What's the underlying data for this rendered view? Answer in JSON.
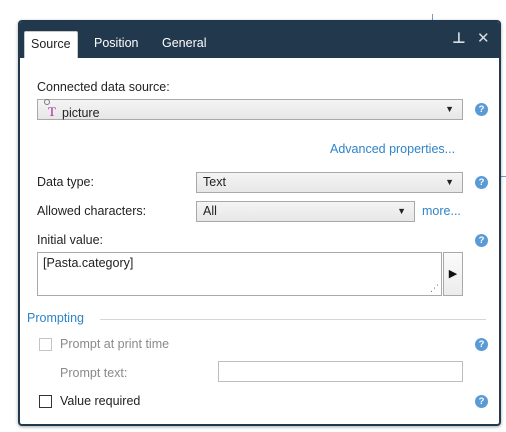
{
  "tabs": [
    "Source",
    "Position",
    "General"
  ],
  "titlebar": {
    "pin_glyph": "⊥",
    "close_glyph": "✕"
  },
  "connected_source": {
    "label": "Connected data source:",
    "value": "picture",
    "icon": "text-variable-icon",
    "icon_glyph": "T"
  },
  "advanced_link": "Advanced properties...",
  "data_type": {
    "label": "Data type:",
    "value": "Text"
  },
  "allowed_chars": {
    "label": "Allowed characters:",
    "value": "All",
    "more_link": "more..."
  },
  "initial_value": {
    "label": "Initial value:",
    "value": "[Pasta.category]",
    "insert_glyph": "▶"
  },
  "prompting": {
    "title": "Prompting",
    "prompt_at_print": {
      "label": "Prompt at print time",
      "checked": false,
      "enabled": false
    },
    "prompt_text": {
      "label": "Prompt text:",
      "value": ""
    },
    "value_required": {
      "label": "Value required",
      "checked": false
    }
  },
  "help_glyph": "?",
  "dropdown_glyph": "▼",
  "colors": {
    "titlebar": "#22384d",
    "accent": "#2f84c8",
    "help": "#5b9bd5"
  }
}
